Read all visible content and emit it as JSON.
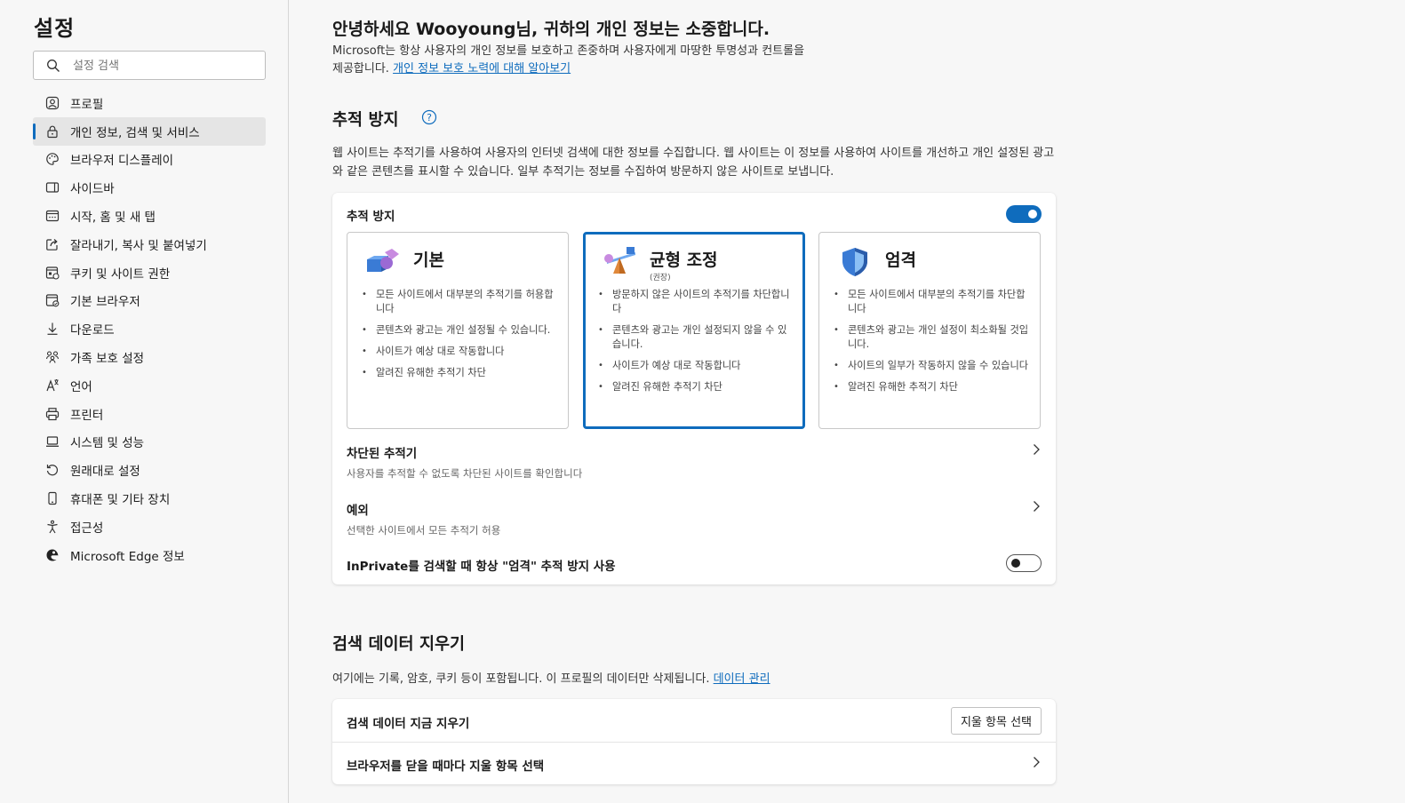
{
  "sidebar": {
    "title": "설정",
    "search_placeholder": "설정 검색",
    "items": [
      {
        "label": "프로필",
        "icon": "profile-icon"
      },
      {
        "label": "개인 정보, 검색 및 서비스",
        "icon": "lock-icon",
        "active": true
      },
      {
        "label": "브라우저 디스플레이",
        "icon": "palette-icon"
      },
      {
        "label": "사이드바",
        "icon": "sidebar-icon"
      },
      {
        "label": "시작, 홈 및 새 탭",
        "icon": "home-tab-icon"
      },
      {
        "label": "잘라내기, 복사 및 붙여넣기",
        "icon": "share-icon"
      },
      {
        "label": "쿠키 및 사이트 권한",
        "icon": "cookie-icon"
      },
      {
        "label": "기본 브라우저",
        "icon": "browser-icon"
      },
      {
        "label": "다운로드",
        "icon": "download-icon"
      },
      {
        "label": "가족 보호 설정",
        "icon": "family-icon"
      },
      {
        "label": "언어",
        "icon": "language-icon"
      },
      {
        "label": "프린터",
        "icon": "printer-icon"
      },
      {
        "label": "시스템 및 성능",
        "icon": "laptop-icon"
      },
      {
        "label": "원래대로 설정",
        "icon": "reset-icon"
      },
      {
        "label": "휴대폰 및 기타 장치",
        "icon": "phone-icon"
      },
      {
        "label": "접근성",
        "icon": "accessibility-icon"
      },
      {
        "label": "Microsoft Edge 정보",
        "icon": "edge-icon"
      }
    ]
  },
  "greeting": {
    "title": "안녕하세요 Wooyoung님, 귀하의 개인 정보는 소중합니다.",
    "desc": "Microsoft는 항상 사용자의 개인 정보를 보호하고 존중하며 사용자에게 마땅한 투명성과 컨트롤을 제공합니다. ",
    "link": "개인 정보 보호 노력에 대해 알아보기"
  },
  "tracking": {
    "title": "추적 방지",
    "desc": "웹 사이트는 추적기를 사용하여 사용자의 인터넷 검색에 대한 정보를 수집합니다. 웹 사이트는 이 정보를 사용하여 사이트를 개선하고 개인 설정된 광고와 같은 콘텐츠를 표시할 수 있습니다. 일부 추적기는 정보를 수집하여 방문하지 않은 사이트로 보냅니다.",
    "toggle_label": "추적 방지",
    "toggle_on": true,
    "levels": [
      {
        "title": "기본",
        "subtitle": "",
        "bullets": [
          "모든 사이트에서 대부분의 추적기를 허용합니다",
          "콘텐츠와 광고는 개인 설정될 수 있습니다.",
          "사이트가 예상 대로 작동합니다",
          "알려진 유해한 추적기 차단"
        ]
      },
      {
        "title": "균형 조정",
        "subtitle": "(권장)",
        "bullets": [
          "방문하지 않은 사이트의 추적기를 차단합니다",
          "콘텐츠와 광고는 개인 설정되지 않을 수 있습니다.",
          "사이트가 예상 대로 작동합니다",
          "알려진 유해한 추적기 차단"
        ]
      },
      {
        "title": "엄격",
        "subtitle": "",
        "bullets": [
          "모든 사이트에서 대부분의 추적기를 차단합니다",
          "콘텐츠와 광고는 개인 설정이 최소화될 것입니다.",
          "사이트의 일부가 작동하지 않을 수 있습니다",
          "알려진 유해한 추적기 차단"
        ]
      }
    ],
    "selected_level": 1,
    "blocked_title": "차단된 추적기",
    "blocked_sub": "사용자를 추적할 수 없도록 차단된 사이트를 확인합니다",
    "exceptions_title": "예외",
    "exceptions_sub": "선택한 사이트에서 모든 추적기 허용",
    "inprivate_label": "InPrivate를 검색할 때 항상 \"엄격\" 추적 방지 사용",
    "inprivate_on": false
  },
  "clear": {
    "title": "검색 데이터 지우기",
    "desc": "여기에는 기록, 암호, 쿠키 등이 포함됩니다. 이 프로필의 데이터만 삭제됩니다. ",
    "link": "데이터 관리",
    "now_label": "검색 데이터 지금 지우기",
    "choose_button": "지울 항목 선택",
    "on_close_label": "브라우저를 닫을 때마다 지울 항목 선택"
  },
  "colors": {
    "accent": "#0f6cbd"
  }
}
